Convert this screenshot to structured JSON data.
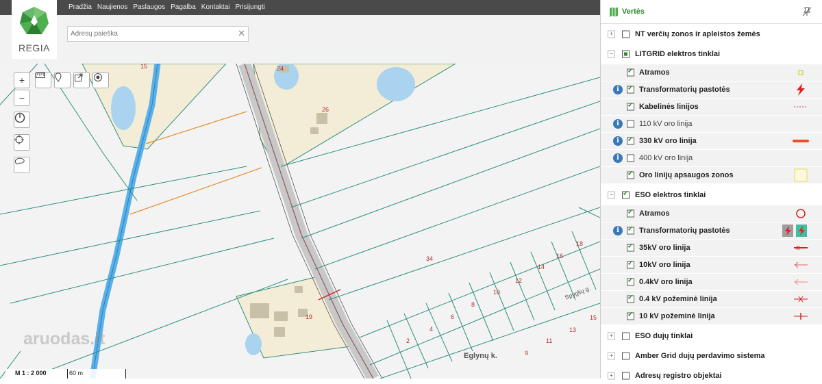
{
  "header": {
    "logo_text": "REGIA",
    "nav": [
      "Pradžia",
      "Naujienos",
      "Paslaugos",
      "Pagalba",
      "Kontaktai",
      "Prisijungti"
    ],
    "search_placeholder": "Adresų paieška"
  },
  "map": {
    "labels": [
      "15",
      "24",
      "26",
      "34",
      "19",
      "18",
      "16",
      "14",
      "12",
      "10",
      "8",
      "6",
      "4",
      "2",
      "13",
      "11",
      "9",
      "15"
    ],
    "street_labels": [
      "Eglynų k.",
      "Spyglių g."
    ],
    "scale": "M 1 : 2 000",
    "scale_distance": "60 m",
    "watermark": "aruodas.lt"
  },
  "panel": {
    "title": "Vertės",
    "icon": "map-icon",
    "rows": [
      {
        "type": "group",
        "label": "NT verčių zonos ir apleistos žemės",
        "expander": "+",
        "check": "none"
      },
      {
        "type": "group",
        "label": "LITGRID elektros tinklai",
        "expander": "−",
        "check": "partial"
      },
      {
        "type": "item",
        "label": "Atramos",
        "check": "checked",
        "info": false,
        "symbol": "small-square"
      },
      {
        "type": "item",
        "label": "Transformatorių pastotės",
        "check": "checked",
        "info": true,
        "symbol": "lightning-red"
      },
      {
        "type": "item",
        "label": "Kabelinės linijos",
        "check": "checked",
        "info": false,
        "symbol": "dotted-red"
      },
      {
        "type": "item",
        "label": "110 kV oro linija",
        "check": "none",
        "info": true,
        "symbol": ""
      },
      {
        "type": "item",
        "label": "330 kV oro linija",
        "check": "checked",
        "info": true,
        "symbol": "thick-orange-red"
      },
      {
        "type": "item",
        "label": "400 kV oro linija",
        "check": "none",
        "info": true,
        "symbol": ""
      },
      {
        "type": "item",
        "label": "Oro linijų apsaugos zonos",
        "check": "checked",
        "info": false,
        "symbol": "yellow-square"
      },
      {
        "type": "group",
        "label": "ESO elektros tinklai",
        "expander": "−",
        "check": "checked"
      },
      {
        "type": "item",
        "label": "Atramos",
        "check": "checked",
        "info": false,
        "symbol": "red-circle"
      },
      {
        "type": "item",
        "label": "Transformatorių pastotės",
        "check": "checked",
        "info": true,
        "symbol": "lightning-boxes"
      },
      {
        "type": "item",
        "label": "35kV oro linija",
        "check": "checked",
        "info": false,
        "symbol": "line-x"
      },
      {
        "type": "item",
        "label": "10kV oro linija",
        "check": "checked",
        "info": false,
        "symbol": "line-arrow"
      },
      {
        "type": "item",
        "label": "0.4kV oro linija",
        "check": "checked",
        "info": false,
        "symbol": "line-arrow-light"
      },
      {
        "type": "item",
        "label": "0.4 kV požeminė linija",
        "check": "checked",
        "info": false,
        "symbol": "line-cross"
      },
      {
        "type": "item",
        "label": "10 kV požeminė linija",
        "check": "checked",
        "info": false,
        "symbol": "line-tick"
      },
      {
        "type": "group",
        "label": "ESO dujų tinklai",
        "expander": "+",
        "check": "none"
      },
      {
        "type": "group",
        "label": "Amber Grid dujų perdavimo sistema",
        "expander": "+",
        "check": "none"
      },
      {
        "type": "group",
        "label": "Adresų registro objektai",
        "expander": "+",
        "check": "none"
      }
    ],
    "colors": {
      "accent_green": "#2a8a2a",
      "info_blue": "#3b78b5",
      "line_red": "#d62020"
    }
  }
}
